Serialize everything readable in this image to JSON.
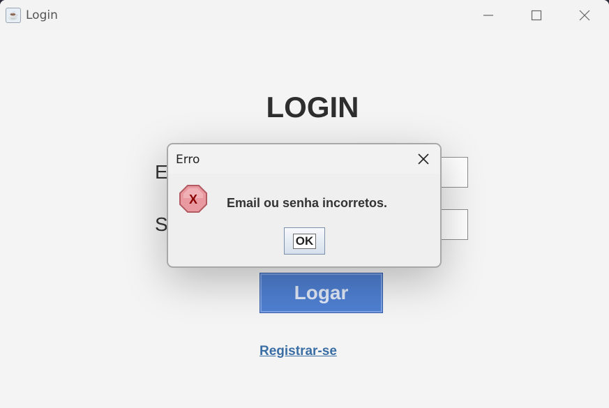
{
  "window": {
    "title": "Login"
  },
  "titlebar": {
    "icons": [
      "java-icon",
      "minimize-icon",
      "maximize-icon",
      "close-icon"
    ]
  },
  "form": {
    "heading": "LOGIN",
    "email_label_visible": "E",
    "senha_label_visible": "S",
    "email_value": "",
    "senha_value": "",
    "login_button": "Logar",
    "register_link": "Registrar-se"
  },
  "dialog": {
    "title": "Erro",
    "message": "Email ou senha incorretos.",
    "ok_button": "OK",
    "icon": "error-x-icon"
  },
  "colors": {
    "login_button": "#4f7fd1",
    "link": "#3a6ea5",
    "error_icon": "#e0888c"
  }
}
